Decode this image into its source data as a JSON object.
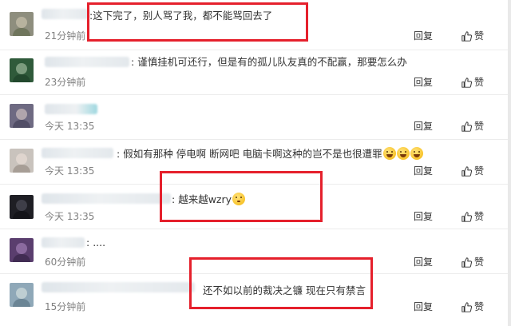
{
  "comments": [
    {
      "text": "这下完了，别人骂了我，都不能骂回去了",
      "time": "21分钟前",
      "reply": "回复",
      "like": "赞"
    },
    {
      "text": "谨慎挂机可还行，但是有的孤儿队友真的不配赢，那要怎么办",
      "time": "23分钟前",
      "reply": "回复",
      "like": "赞"
    },
    {
      "text": "",
      "time": "今天 13:35",
      "reply": "回复",
      "like": "赞"
    },
    {
      "text": "假如有那种 停电啊 断网吧 电脑卡啊这种的岂不是也很遭罪",
      "time": "今天 13:35",
      "reply": "回复",
      "like": "赞",
      "emojis": [
        "laugh-cry-emoji",
        "laugh-cry-emoji",
        "laugh-cry-emoji"
      ]
    },
    {
      "text": "越来越wzry",
      "time": "今天 13:35",
      "reply": "回复",
      "like": "赞",
      "emojis": [
        "thinking-emoji"
      ]
    },
    {
      "text": "....",
      "time": "60分钟前",
      "reply": "回复",
      "like": "赞"
    },
    {
      "text": "还不如以前的裁决之镰  现在只有禁言",
      "time": "15分钟前",
      "reply": "回复",
      "like": "赞"
    }
  ],
  "colors": {
    "highlight_box": "#e5202c",
    "time_text": "#808080",
    "body_text": "#333333"
  }
}
